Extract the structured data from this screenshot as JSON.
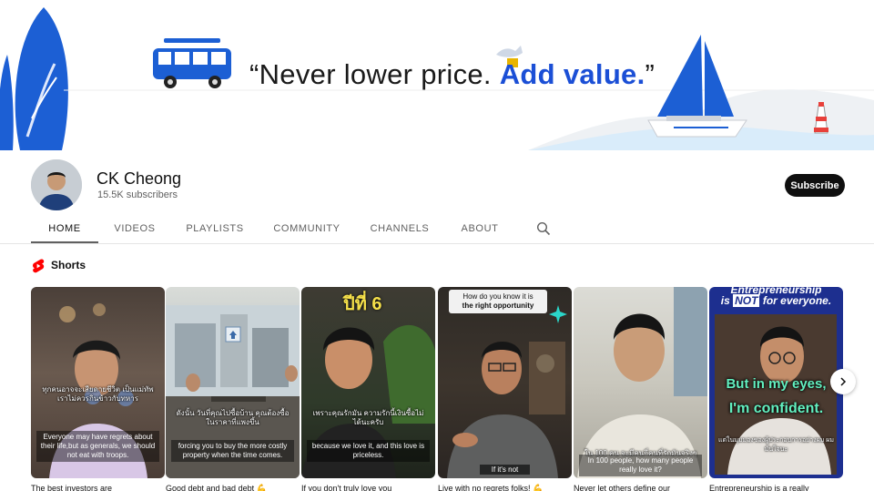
{
  "banner": {
    "quote_open": "“Never lower price. ",
    "quote_strong": "Add value.",
    "quote_close": "”"
  },
  "channel": {
    "name": "CK Cheong",
    "subscribers": "15.5K subscribers",
    "subscribe_label": "Subscribe"
  },
  "tabs": [
    {
      "label": "HOME",
      "active": true
    },
    {
      "label": "VIDEOS"
    },
    {
      "label": "PLAYLISTS"
    },
    {
      "label": "COMMUNITY"
    },
    {
      "label": "CHANNELS"
    },
    {
      "label": "ABOUT"
    }
  ],
  "search_icon": "search-icon",
  "shorts": {
    "section_title": "Shorts",
    "items": [
      {
        "thai": "ทุกคนอาจจะเสียดายชีวิต เป็นแม่ทัพเราไม่ควรกินข้าวกับทหาร",
        "caption": "Everyone may have regrets about their life,but as generals, we should not eat with troops.",
        "title": "The best investors are"
      },
      {
        "thai": "ดังนั้น วันที่คุณไปซื้อบ้าน คุณต้องซื้อในราคาที่แพงขึ้น",
        "caption": "forcing you to buy the more costly property when the time comes.",
        "title": "Good debt and bad debt 💪"
      },
      {
        "overlay": "ปีที่ 6",
        "thai": "เพราะคุณรักมัน ความรักนี้เงินซื้อไม่ได้นะครับ",
        "caption": "because we love it, and this love is priceless.",
        "title": "If you don't truly love you"
      },
      {
        "header_line1": "How do you know it is",
        "header_line2": "the right opportunity",
        "caption": "If it's not",
        "title": "Live with no regrets folks! 💪"
      },
      {
        "thai": "ใน 100 คน จะมีคนกี่คนที่รักมันจริงๆ",
        "caption": "In 100 people, how many people really love it?",
        "title": "Never let others define our"
      },
      {
        "header_line1": "Entrepreneurship",
        "header_line2a": "is ",
        "header_line2b": "NOT",
        "header_line2c": " for everyone.",
        "quote_line1": "But in my eyes,",
        "quote_line2": "I'm confident.",
        "thai": "แต่ในมุมมองของผู้ประกอบการอย่างผม ผมมั่นใจนะ",
        "title": "Entrepreneurship is a really"
      }
    ]
  },
  "colors": {
    "accent_blue": "#1b4fd6",
    "subscribe_bg": "#0f0f0f",
    "shorts_red": "#ff0000"
  }
}
